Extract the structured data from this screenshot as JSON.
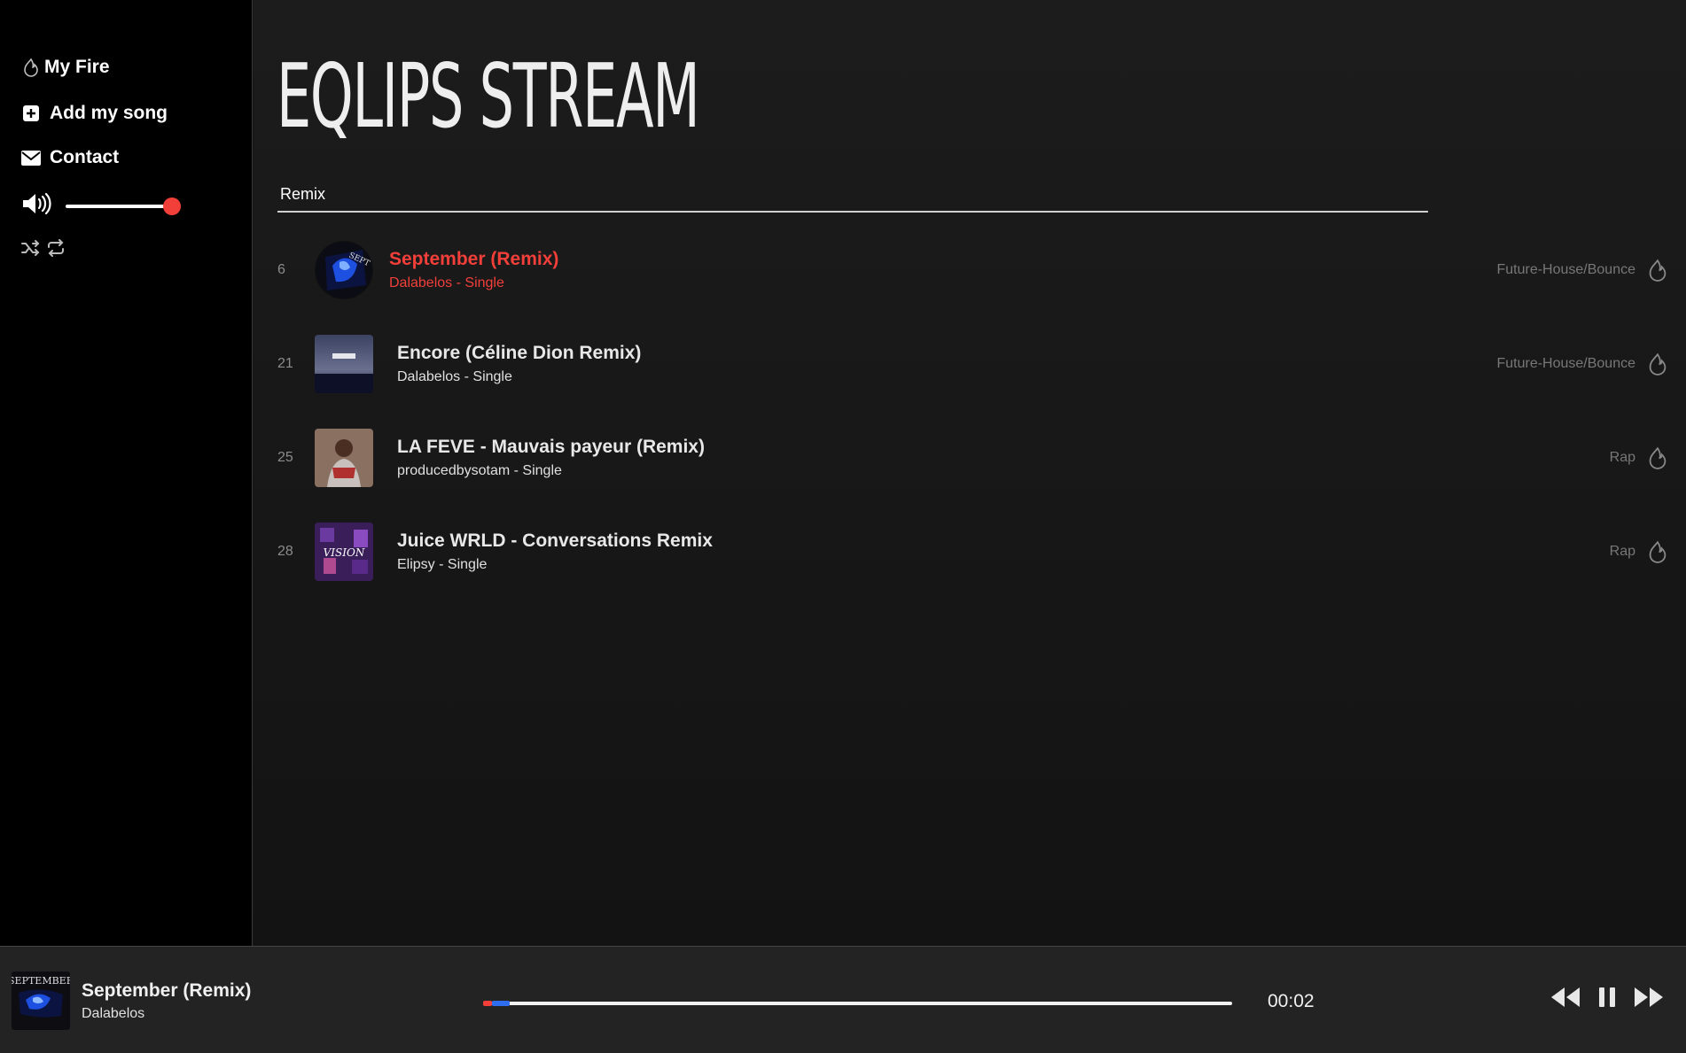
{
  "sidebar": {
    "nav": [
      {
        "label": "My Fire",
        "icon": "fire-icon"
      },
      {
        "label": "Add my song",
        "icon": "plus-square-icon"
      },
      {
        "label": "Contact",
        "icon": "envelope-icon"
      }
    ],
    "volume_level": 1.0,
    "accent_color": "#f23f3a"
  },
  "header": {
    "logo_text": "EQLIPS STREAM"
  },
  "search": {
    "value": "Remix"
  },
  "tracks": [
    {
      "rank": "6",
      "title": "September (Remix)",
      "artist": "Dalabelos",
      "separator": "-",
      "type": "Single",
      "genre": "Future-House/Bounce",
      "active": true
    },
    {
      "rank": "21",
      "title": "Encore (Céline Dion Remix)",
      "artist": "Dalabelos",
      "separator": "-",
      "type": "Single",
      "genre": "Future-House/Bounce",
      "active": false
    },
    {
      "rank": "25",
      "title": "LA FEVE - Mauvais payeur (Remix)",
      "artist": "producedbysotam",
      "separator": "-",
      "type": "Single",
      "genre": "Rap",
      "active": false
    },
    {
      "rank": "28",
      "title": "Juice WRLD - Conversations Remix",
      "artist": "Elipsy",
      "separator": "-",
      "type": "Single",
      "genre": "Rap",
      "active": false
    }
  ],
  "player": {
    "title": "September (Remix)",
    "artist": "Dalabelos",
    "time": "00:02",
    "progress": 0.012,
    "buffered": 0.035
  }
}
